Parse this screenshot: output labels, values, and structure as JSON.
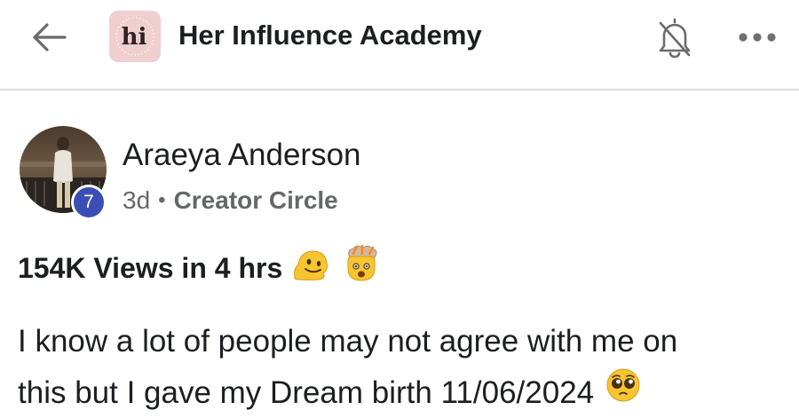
{
  "header": {
    "group_name": "Her Influence Academy",
    "logo_text": "hi",
    "logo_bg": "#f0cfd1",
    "icons": {
      "back": "arrow-left-icon",
      "notifications": "bell-off-icon",
      "more": "more-horizontal-icon"
    }
  },
  "post": {
    "author": {
      "name": "Araeya Anderson",
      "level": "7",
      "level_color": "#3a4fb5"
    },
    "time": "3d",
    "separator": "•",
    "circle": "Creator Circle",
    "title": "154K Views in 4 hrs",
    "title_emojis": [
      "melting-face-emoji",
      "exploding-head-emoji"
    ],
    "body_lines": [
      "I know a lot of people may not agree with me on",
      "this but I gave my Dream birth 11/06/2024"
    ],
    "body_emoji": "pleading-face-emoji"
  }
}
